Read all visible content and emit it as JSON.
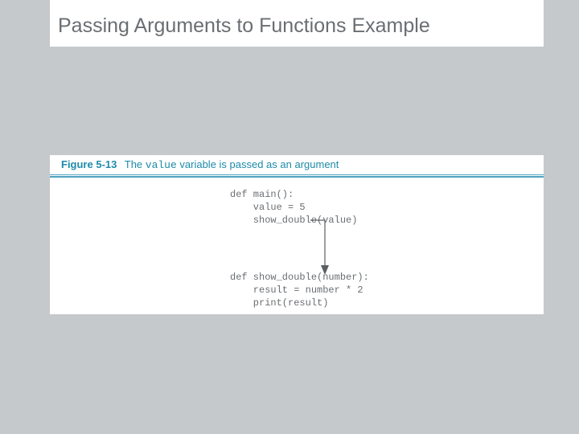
{
  "title": "Passing Arguments to Functions Example",
  "figure": {
    "label": "Figure 5-13",
    "caption_prefix": "The ",
    "caption_code": "value",
    "caption_suffix": " variable is passed as an argument"
  },
  "code": {
    "main": "def main():\n    value = 5\n    show_double(value)",
    "show_double": "def show_double(number):\n    result = number * 2\n    print(result)"
  }
}
